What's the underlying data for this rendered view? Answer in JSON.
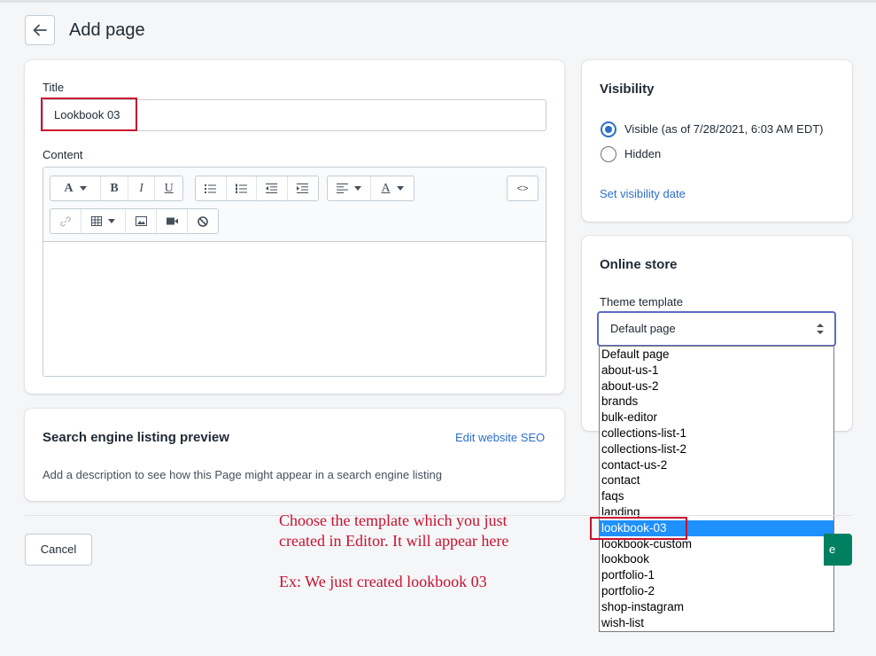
{
  "header": {
    "title": "Add page"
  },
  "main": {
    "title_label": "Title",
    "title_value": "Lookbook 03",
    "content_label": "Content",
    "toolbar": {
      "font_button": "A",
      "bold": "B",
      "italic": "I",
      "underline": "U",
      "text_color": "A",
      "html_button": "<>"
    }
  },
  "visibility": {
    "heading": "Visibility",
    "options": [
      {
        "label": "Visible (as of 7/28/2021, 6:03 AM EDT)",
        "checked": true
      },
      {
        "label": "Hidden",
        "checked": false
      }
    ],
    "set_date_link": "Set visibility date"
  },
  "online_store": {
    "heading": "Online store",
    "template_label": "Theme template",
    "selected": "Default page",
    "options": [
      "Default page",
      "about-us-1",
      "about-us-2",
      "brands",
      "bulk-editor",
      "collections-list-1",
      "collections-list-2",
      "contact-us-2",
      "contact",
      "faqs",
      "landing",
      "lookbook-03",
      "lookbook-custom",
      "lookbook",
      "portfolio-1",
      "portfolio-2",
      "shop-instagram",
      "wish-list"
    ],
    "highlighted": "lookbook-03"
  },
  "seo": {
    "heading": "Search engine listing preview",
    "edit_link": "Edit website SEO",
    "description": "Add a description to see how this Page might appear in a search engine listing"
  },
  "footer": {
    "cancel_label": "Cancel",
    "save_peek": "e"
  },
  "annotation": {
    "line1": "Choose the template which you just",
    "line2": "created in Editor. It will appear here",
    "line3": "Ex: We just created lookbook 03"
  },
  "colors": {
    "accent": "#2c6ecb",
    "annotation": "#c8102e",
    "primary_button": "#008060",
    "selection": "#1e90ff"
  }
}
